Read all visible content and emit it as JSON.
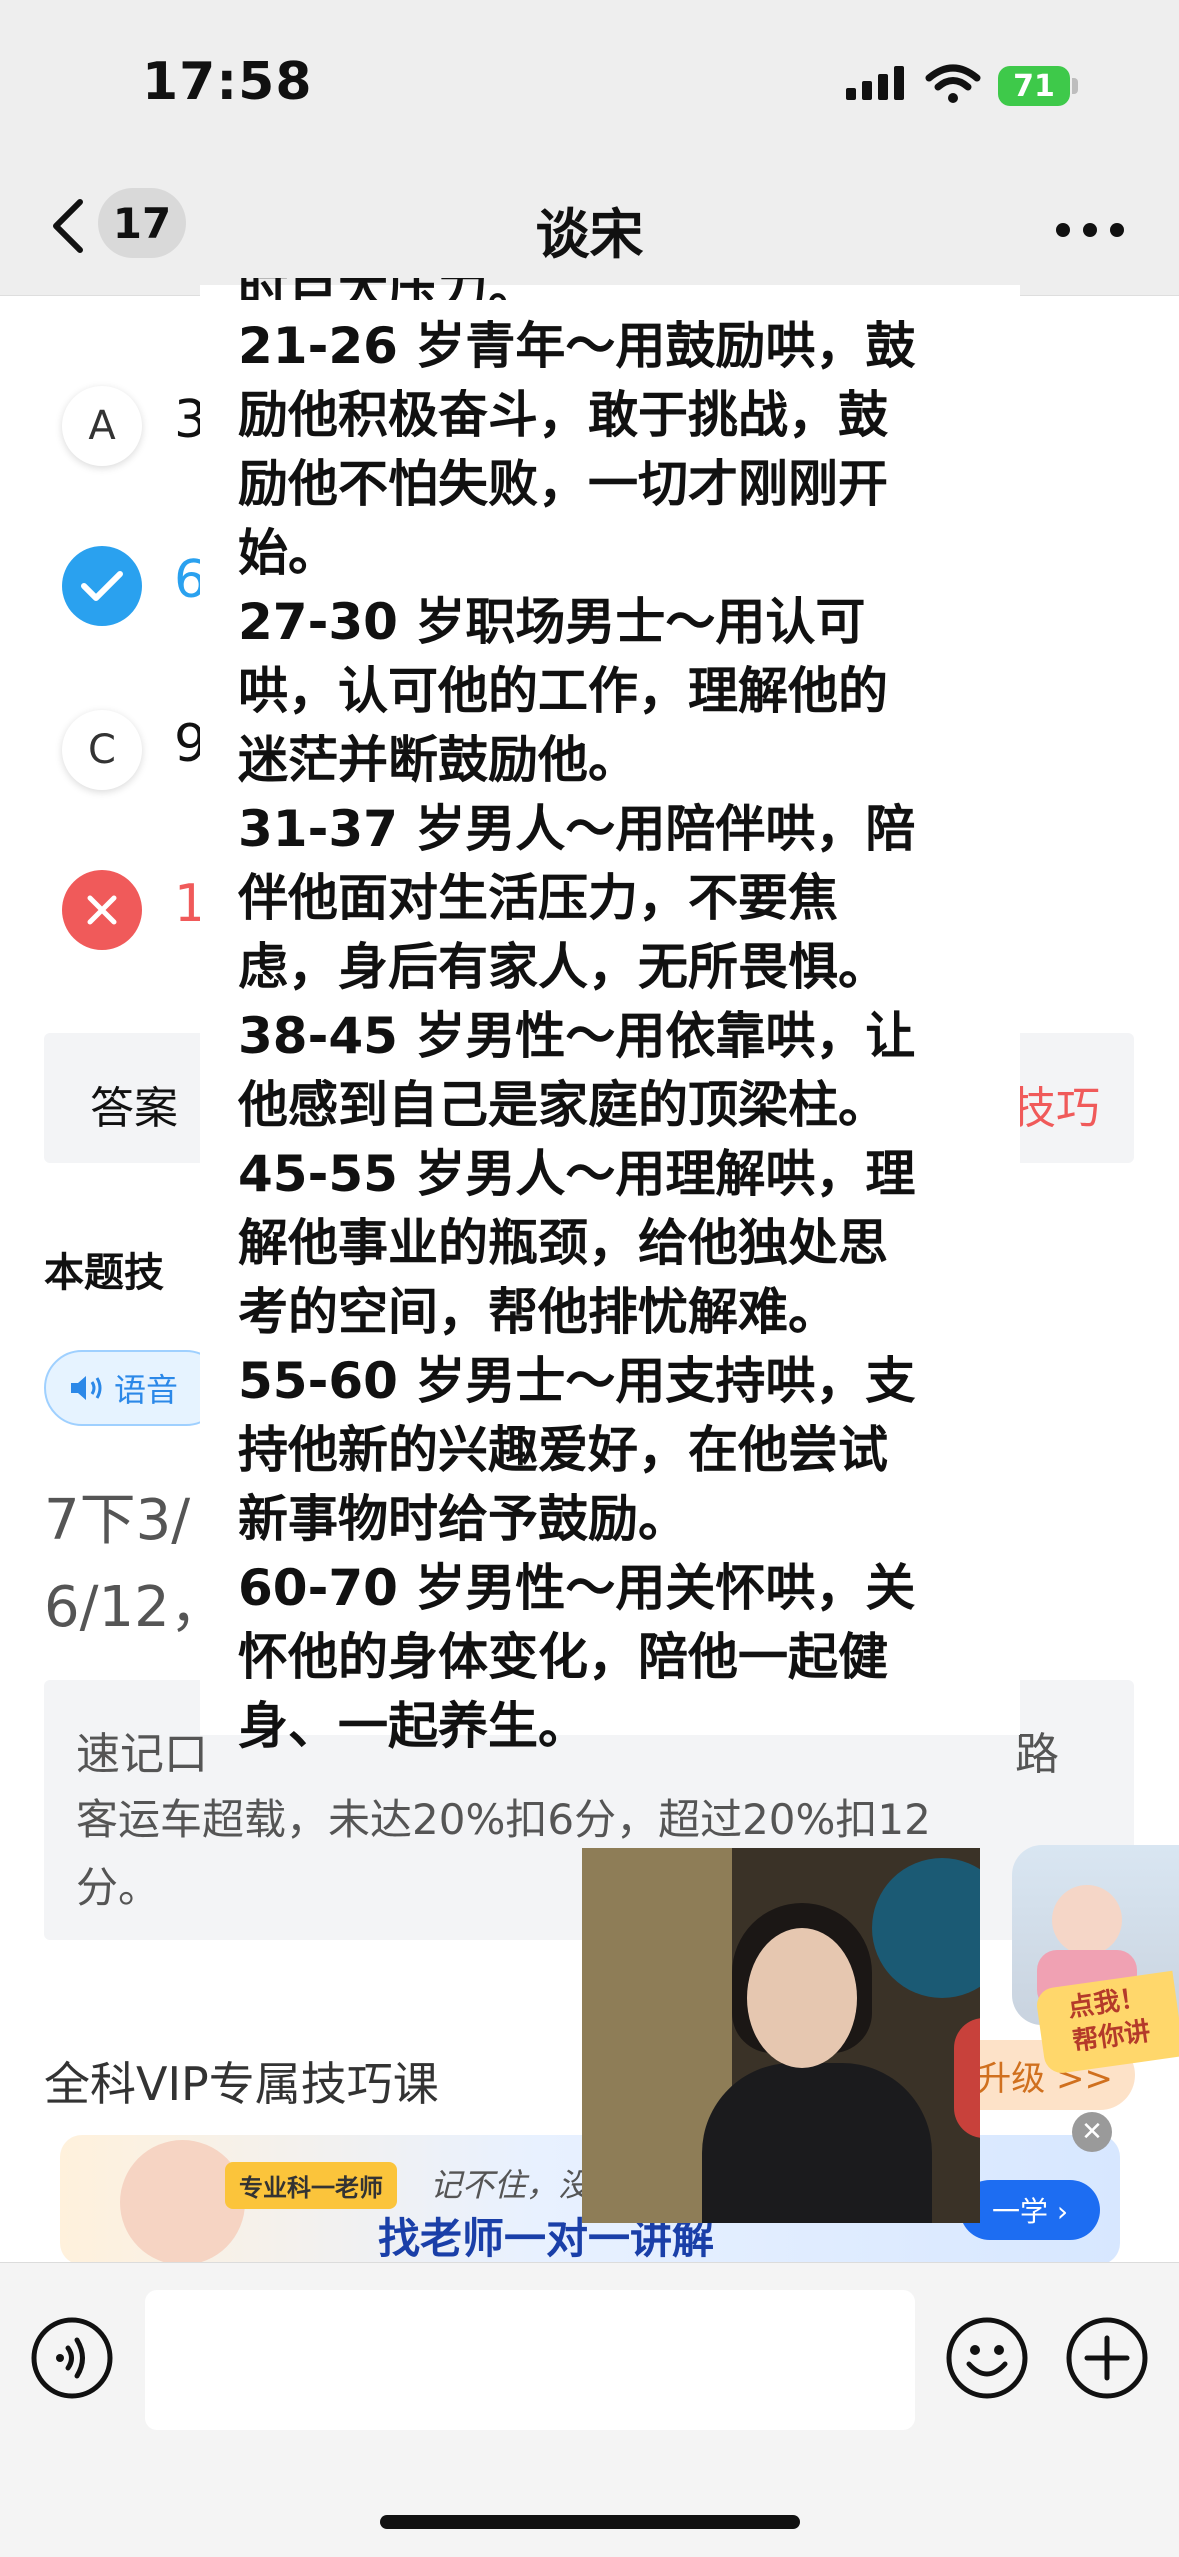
{
  "status_bar": {
    "time": "17:58",
    "battery": "71"
  },
  "nav": {
    "back_count": "17",
    "title": "谈宋"
  },
  "options": [
    {
      "letter": "A",
      "text_visible": "3",
      "state": "neutral",
      "color": "#111111"
    },
    {
      "letter": "",
      "text_visible": "6",
      "state": "correct",
      "color": "#2aa1ef"
    },
    {
      "letter": "C",
      "text_visible": "9",
      "state": "neutral",
      "color": "#111111"
    },
    {
      "letter": "",
      "text_visible": "1",
      "state": "wrong",
      "color": "#f05a5a"
    }
  ],
  "answer_bar": {
    "label": "答案",
    "right_fragment": "技巧"
  },
  "skill": {
    "heading_visible": "本题技",
    "voice_label": "语音"
  },
  "memo": {
    "line1": "7下3/",
    "line2": "6/12，"
  },
  "tip": {
    "line1_start": "速记口",
    "line1_end": "路",
    "line2": "客运车超载，未达20%扣6分，超过20%扣12",
    "line3": "分。"
  },
  "vip": {
    "title": "全科VIP专属技巧课",
    "upgrade": "即升级 >>"
  },
  "banner": {
    "tag": "专业科一老师",
    "subtitle": "记不住，没",
    "main": "找老师一对一讲解",
    "button": "一学 ›"
  },
  "helper": {
    "tag_line1": "点我！",
    "tag_line2": "帮你讲"
  },
  "overlay": {
    "cut_line": "时巨大压力。",
    "lines": [
      "21-26 岁青年～用鼓励哄，鼓",
      "励他积极奋斗，敢于挑战，鼓",
      "励他不怕失败，一切才刚刚开",
      "始。",
      "27-30 岁职场男士～用认可",
      "哄，认可他的工作，理解他的",
      "迷茫并断鼓励他。",
      "31-37 岁男人～用陪伴哄，陪",
      "伴他面对生活压力，不要焦",
      "虑，身后有家人，无所畏惧。",
      "38-45 岁男性～用依靠哄，让",
      "他感到自己是家庭的顶梁柱。",
      "45-55 岁男人～用理解哄，理",
      "解他事业的瓶颈，给他独处思",
      "考的空间，帮他排忧解难。",
      "55-60 岁男士～用支持哄，支",
      "持他新的兴趣爱好，在他尝试",
      "新事物时给予鼓励。",
      "60-70 岁男性～用关怀哄，关",
      "怀他的身体变化，陪他一起健",
      "身、一起养生。"
    ]
  }
}
